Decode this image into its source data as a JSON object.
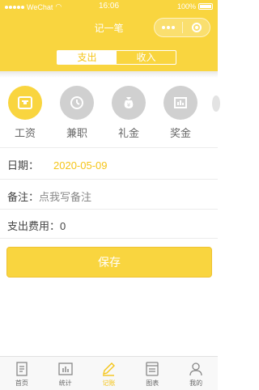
{
  "status_bar": {
    "carrier": "WeChat",
    "time": "16:06",
    "battery": "100%"
  },
  "nav": {
    "title": "记一笔"
  },
  "toggle": {
    "options": [
      "支出",
      "收入"
    ],
    "selected": "支出"
  },
  "categories": [
    {
      "label": "工资",
      "icon": "wallet-icon",
      "active": true
    },
    {
      "label": "兼职",
      "icon": "clock-icon",
      "active": false
    },
    {
      "label": "礼金",
      "icon": "money-bag-icon",
      "active": false
    },
    {
      "label": "奖金",
      "icon": "bonus-card-icon",
      "active": false
    }
  ],
  "form": {
    "date_label": "日期：",
    "date_value": "2020-05-09",
    "note_label": "备注：",
    "note_placeholder": "点我写备注",
    "amount_label": "支出费用：",
    "amount_value": "0"
  },
  "save_button": "保存",
  "tabbar": {
    "items": [
      {
        "label": "首页",
        "icon": "home-doc-icon",
        "active": false
      },
      {
        "label": "统计",
        "icon": "bar-chart-icon",
        "active": false
      },
      {
        "label": "记账",
        "icon": "pencil-icon",
        "active": true
      },
      {
        "label": "图表",
        "icon": "report-icon",
        "active": false
      },
      {
        "label": "我的",
        "icon": "user-icon",
        "active": false
      }
    ]
  },
  "colors": {
    "accent": "#f9d53f",
    "accent_text": "#f5c518",
    "inactive_icon": "#d0d0d0"
  }
}
